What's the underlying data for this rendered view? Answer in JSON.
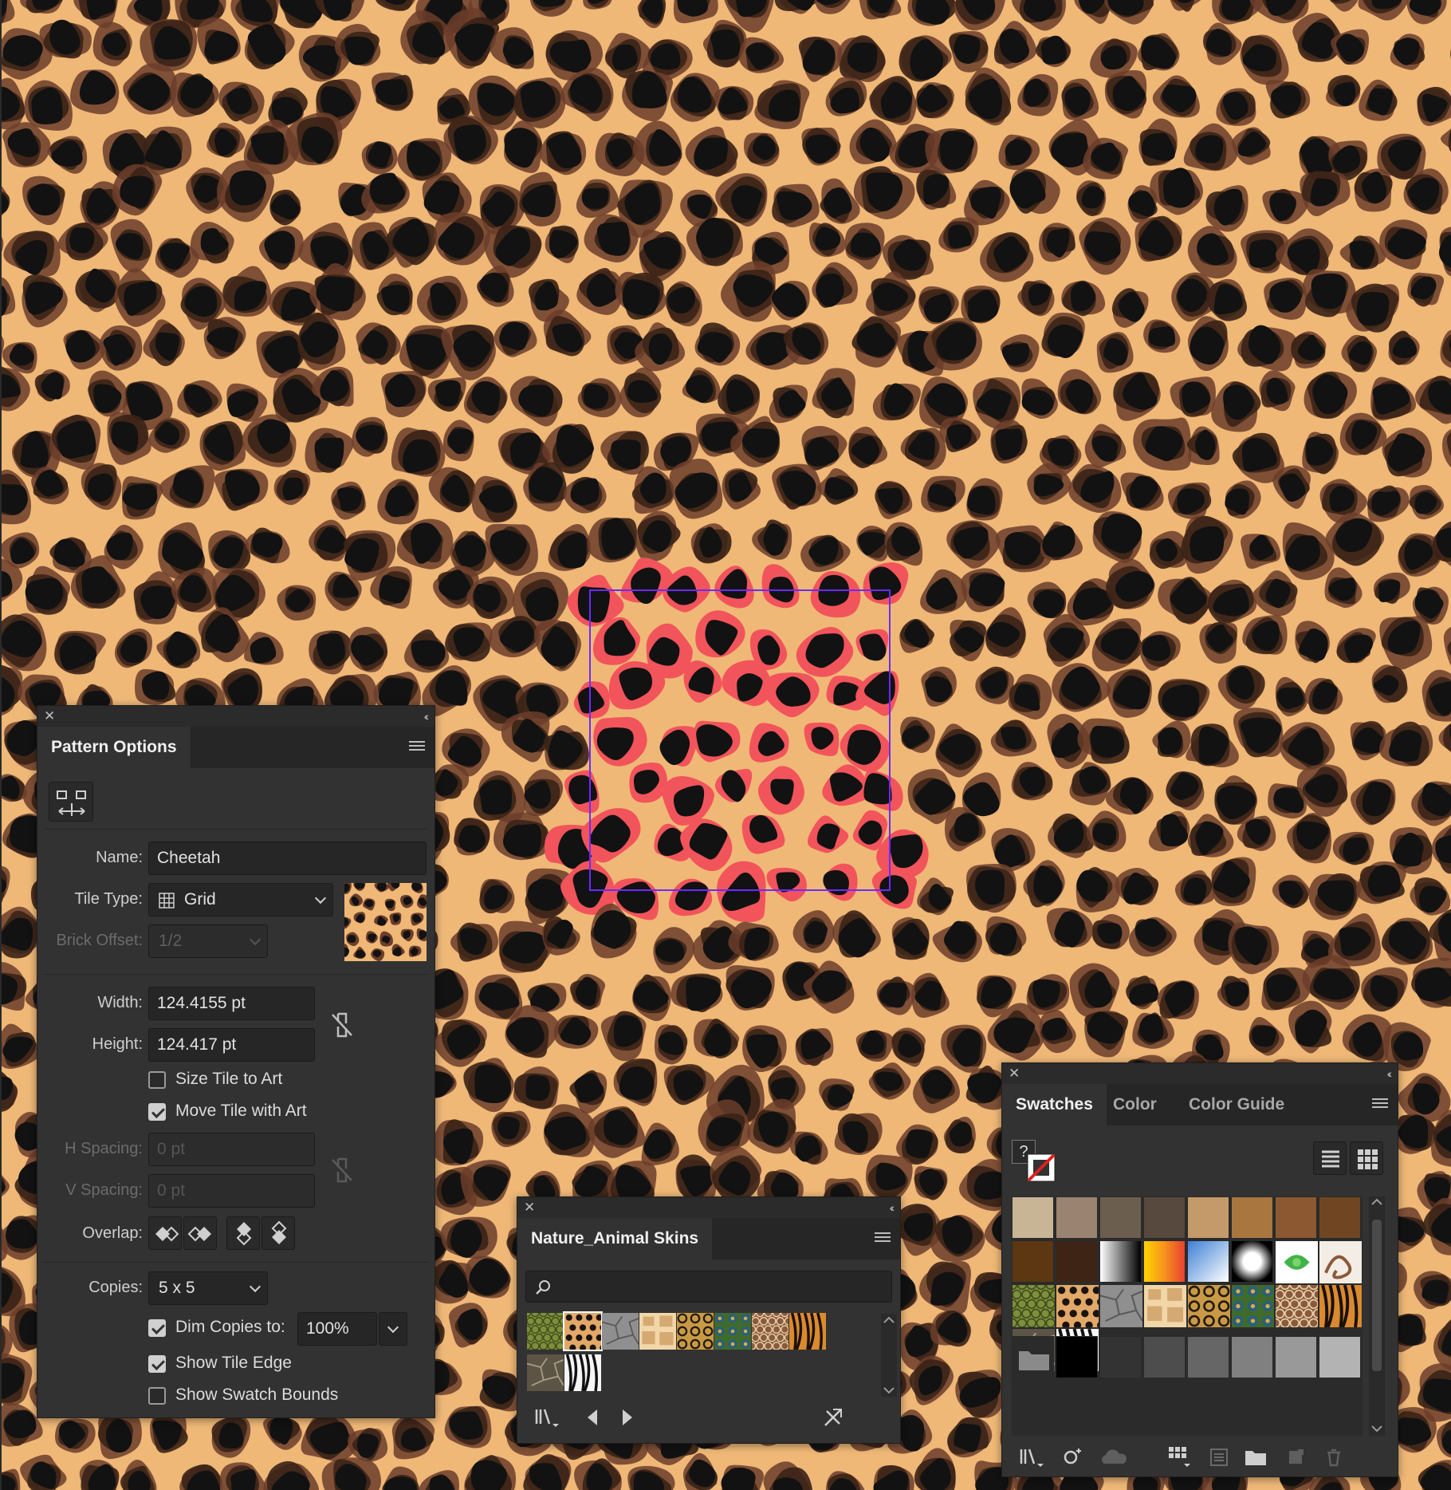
{
  "colors": {
    "background": "#efb877",
    "spot": "#121212",
    "spot_halo": "#6b3d2a",
    "selected_spot_fill": "#f2545b",
    "tile_edge": "#6a2bff",
    "panel_bg": "#323232"
  },
  "pattern_options": {
    "tab": "Pattern Options",
    "name_label": "Name:",
    "name_value": "Cheetah",
    "tile_type_label": "Tile Type:",
    "tile_type_value": "Grid",
    "tile_type_icon": "grid-icon",
    "brick_offset_label": "Brick Offset:",
    "brick_offset_value": "1/2",
    "width_label": "Width:",
    "width_value": "124.4155 pt",
    "height_label": "Height:",
    "height_value": "124.417 pt",
    "size_tile_to_art": "Size Tile to Art",
    "size_tile_to_art_checked": false,
    "move_tile_with_art": "Move Tile with Art",
    "move_tile_with_art_checked": true,
    "h_spacing_label": "H Spacing:",
    "h_spacing_value": "0 pt",
    "v_spacing_label": "V Spacing:",
    "v_spacing_value": "0 pt",
    "overlap_label": "Overlap:",
    "copies_label": "Copies:",
    "copies_value": "5 x 5",
    "dim_copies": "Dim Copies to:",
    "dim_copies_checked": true,
    "dim_copies_value": "100%",
    "show_tile_edge": "Show Tile Edge",
    "show_tile_edge_checked": true,
    "show_swatch_bounds": "Show Swatch Bounds",
    "show_swatch_bounds_checked": false
  },
  "library_panel": {
    "tab": "Nature_Animal Skins",
    "search_placeholder": "",
    "swatches": [
      "Snake green",
      "Cheetah",
      "Elephant",
      "Giraffe",
      "Leopard",
      "Peacock",
      "Snake brown",
      "Tiger",
      "Turtle",
      "Zebra"
    ]
  },
  "swatches_panel": {
    "tabs": [
      "Swatches",
      "Color",
      "Color Guide"
    ],
    "active_tab": "Swatches",
    "solid_colors": [
      "#c8b596",
      "#9b8371",
      "#6b5e4f",
      "#57493d",
      "#c49a6a",
      "#a9763f",
      "#8b5832",
      "#6f4621",
      "#5c3712",
      "#3e2414"
    ],
    "pattern_swatches": [
      "Snake green",
      "Cheetah",
      "Elephant",
      "Giraffe",
      "Leopard",
      "Peacock",
      "Snake brown",
      "Tiger",
      "Turtle",
      "Zebra"
    ],
    "gray_group": [
      "#000000",
      "#333333",
      "#4d4d4d",
      "#666666",
      "#808080",
      "#999999",
      "#b3b3b3"
    ]
  }
}
